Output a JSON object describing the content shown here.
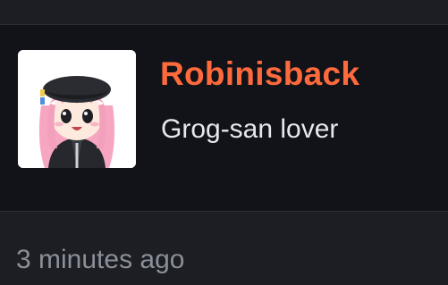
{
  "profile": {
    "username": "Robinisback",
    "bio": "Grog-san lover",
    "avatar_icon": "anime-girl-avatar-icon"
  },
  "footer": {
    "timestamp": "3 minutes ago"
  },
  "colors": {
    "background": "#111318",
    "panel": "#1c1e24",
    "username": "#ff6a3d",
    "bio": "#e6e8ee",
    "timestamp": "#8b8f98"
  }
}
